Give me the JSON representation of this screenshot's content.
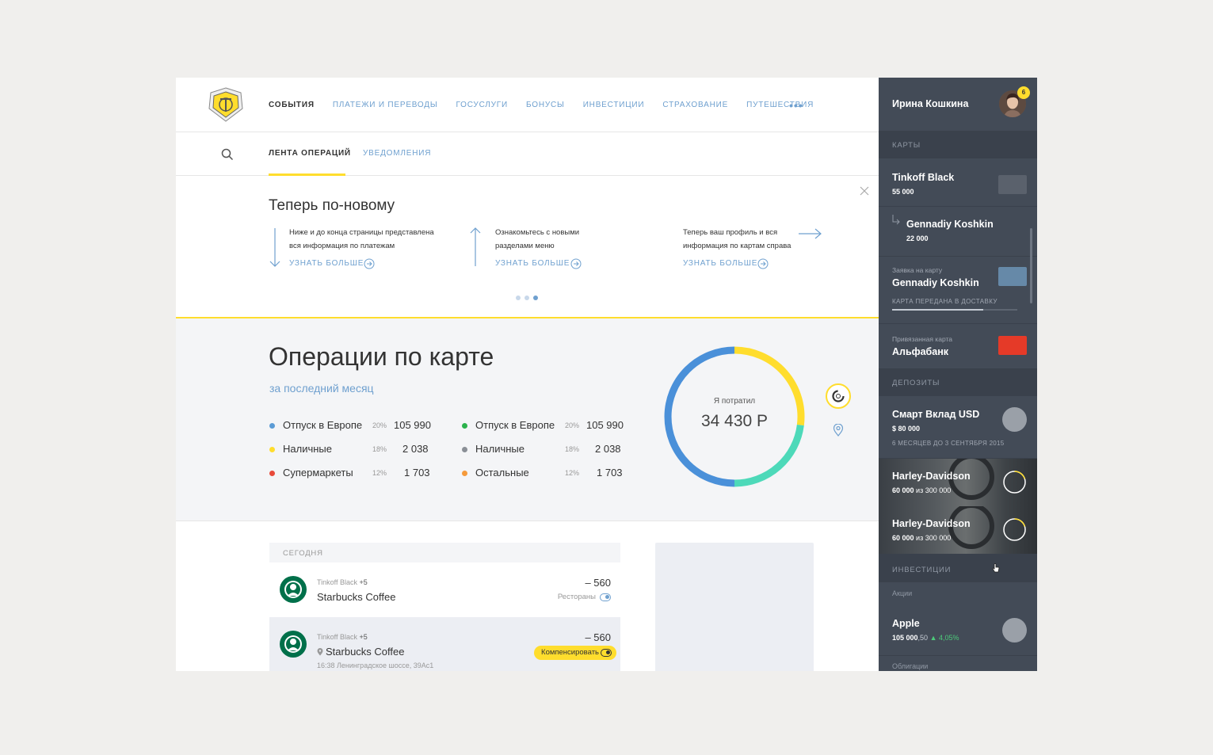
{
  "nav": {
    "items": [
      "СОБЫТИЯ",
      "ПЛАТЕЖИ И ПЕРЕВОДЫ",
      "ГОСУСЛУГИ",
      "БОНУСЫ",
      "ИНВЕСТИЦИИ",
      "СТРАХОВАНИЕ",
      "ПУТЕШЕСТВИЯ"
    ],
    "more": "•••"
  },
  "subnav": {
    "tab_feed": "ЛЕНТА ОПЕРАЦИЙ",
    "tab_notifications": "УВЕДОМЛЕНИЯ"
  },
  "promo": {
    "title": "Теперь по-новому",
    "tips": [
      {
        "text": "Ниже и до конца страницы представлена вся информация по платежам",
        "link": "УЗНАТЬ БОЛЬШЕ"
      },
      {
        "text": "Ознакомьтесь  с новыми разделами меню",
        "link": "УЗНАТЬ БОЛЬШЕ"
      },
      {
        "text": "Теперь ваш профиль и вся информация по картам справа",
        "link": "УЗНАТЬ БОЛЬШЕ"
      }
    ],
    "active_dot": 3
  },
  "ops": {
    "title": "Операции по карте",
    "subtitle": "за последний месяц",
    "categories_left": [
      {
        "name": "Отпуск в Европе",
        "pct": "20%",
        "amount": "105 990",
        "color": "#5b9bd5"
      },
      {
        "name": "Наличные",
        "pct": "18%",
        "amount": "2 038",
        "color": "#ffdd2d"
      },
      {
        "name": "Супермаркеты",
        "pct": "12%",
        "amount": "1 703",
        "color": "#e84a3a"
      }
    ],
    "categories_right": [
      {
        "name": "Отпуск в Европе",
        "pct": "20%",
        "amount": "105 990",
        "color": "#2bb24c"
      },
      {
        "name": "Наличные",
        "pct": "18%",
        "amount": "2 038",
        "color": "#8a8f96"
      },
      {
        "name": "Остальные",
        "pct": "12%",
        "amount": "1 703",
        "color": "#f59a3b"
      }
    ],
    "donut_label": "Я потратил",
    "donut_value": "34 430 Р",
    "donut_segments": [
      {
        "value": 0.27,
        "color": "#ffdd2d"
      },
      {
        "value": 0.23,
        "color": "#4dd9b9"
      },
      {
        "value": 0.5,
        "color": "#4a90d9"
      }
    ]
  },
  "feed": {
    "section": "СЕГОДНЯ",
    "rows": [
      {
        "card": "Tinkoff Black",
        "bonus": "+5",
        "name": "Starbucks Coffee",
        "amount": "– 560",
        "category": "Рестораны"
      },
      {
        "card": "Tinkoff Black",
        "bonus": "+5",
        "name": "Starbucks Coffee",
        "amount": "– 560",
        "action": "Компенсировать",
        "meta": "16:38    Ленинградское шоссе, 39Ас1"
      }
    ]
  },
  "sidebar": {
    "user": "Ирина Кошкина",
    "badge": "6",
    "cards_title": "КАРТЫ",
    "cards": [
      {
        "name": "Tinkoff Black",
        "amount": "55 000",
        "color": "#5a616c"
      },
      {
        "name": "Gennadiy Koshkin",
        "amount": "22 000"
      },
      {
        "caption": "Заявка на карту",
        "name": "Gennadiy Koshkin",
        "status": "КАРТА ПЕРЕДАНА В ДОСТАВКУ",
        "color": "#6689a8"
      },
      {
        "caption": "Привязанная карта",
        "name": "Альфабанк",
        "color": "#e53a28"
      }
    ],
    "deposits_title": "ДЕПОЗИТЫ",
    "deposit": {
      "name": "Смарт Вклад USD",
      "amount": "$ 80 000",
      "caption": "6 МЕСЯЦЕВ ДО 3 СЕНТЯБРЯ 2015"
    },
    "goals": [
      {
        "name": "Harley-Davidson",
        "saved": "60 000",
        "of": "из 300 000",
        "progress": 0.2
      },
      {
        "name": "Harley-Davidson",
        "saved": "60 000",
        "of": "из 300 000",
        "progress": 0.2
      }
    ],
    "investments_title": "ИНВЕСТИЦИИ",
    "stocks_title": "Акции",
    "stock": {
      "name": "Apple",
      "price": "105 000",
      "price_decimals": ",50",
      "change": "4,05%"
    },
    "bonds_title": "Облигации"
  }
}
